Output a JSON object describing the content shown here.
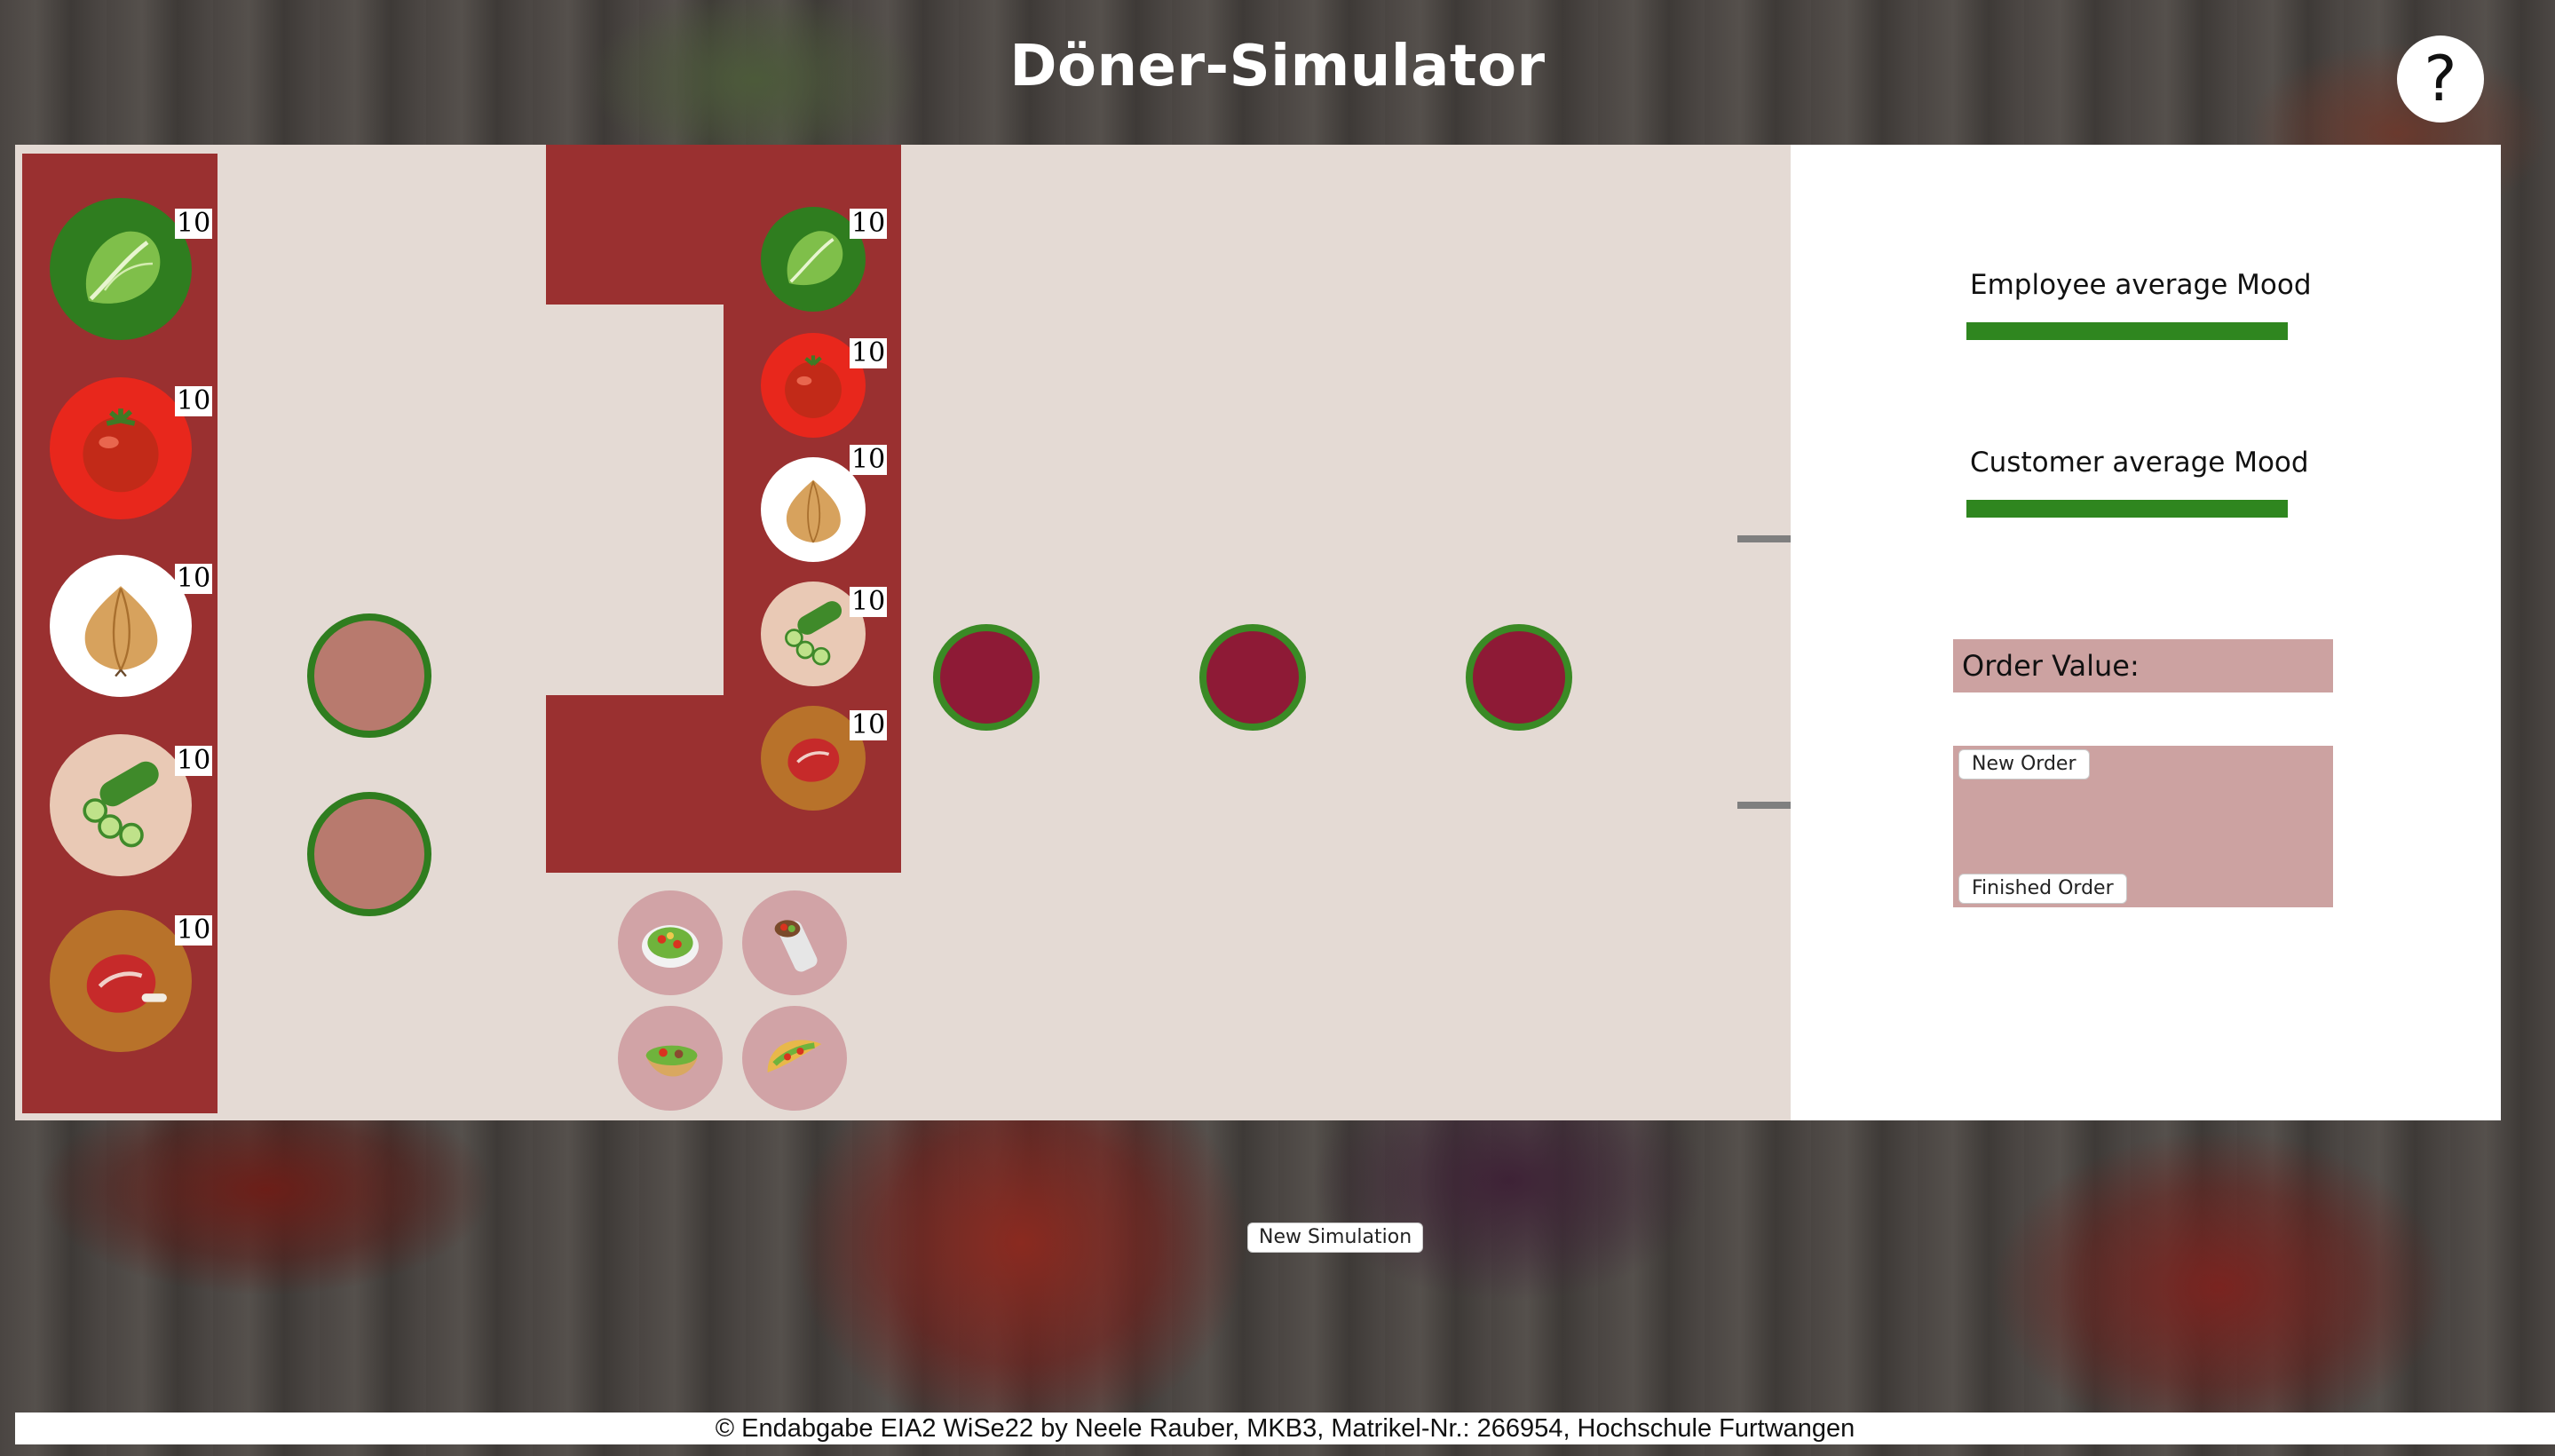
{
  "app": {
    "title": "Döner-Simulator",
    "help_label": "?"
  },
  "storage": {
    "items": [
      {
        "name": "lettuce",
        "count": "10",
        "color": "#2f7d1f"
      },
      {
        "name": "tomato",
        "count": "10",
        "color": "#e8271c"
      },
      {
        "name": "onion",
        "count": "10",
        "color": "#ffffff"
      },
      {
        "name": "cucumber",
        "count": "10",
        "color": "#e9c9b5"
      },
      {
        "name": "meat",
        "count": "10",
        "color": "#b8722a"
      }
    ]
  },
  "counter": {
    "items": [
      {
        "name": "lettuce",
        "count": "10",
        "color": "#2f7d1f"
      },
      {
        "name": "tomato",
        "count": "10",
        "color": "#e8271c"
      },
      {
        "name": "onion",
        "count": "10",
        "color": "#ffffff"
      },
      {
        "name": "cucumber",
        "count": "10",
        "color": "#e9c9b5"
      },
      {
        "name": "meat",
        "count": "10",
        "color": "#b8722a"
      }
    ],
    "meals": [
      "salad-icon",
      "wrap-icon",
      "pita-icon",
      "taco-icon"
    ]
  },
  "mood": {
    "employee_label": "Employee average Mood",
    "customer_label": "Customer average Mood",
    "employee_level": 1.0,
    "customer_level": 1.0,
    "bar_color": "#2f861f"
  },
  "orders": {
    "value_label": "Order Value:",
    "new_order_label": "New Order",
    "finished_order_label": "Finished Order"
  },
  "controls": {
    "new_simulation_label": "New Simulation"
  },
  "footer": {
    "text": "© Endabgabe EIA2 WiSe22 by Neele Rauber, MKB3, Matrikel-Nr.: 266954, Hochschule Furtwangen"
  }
}
